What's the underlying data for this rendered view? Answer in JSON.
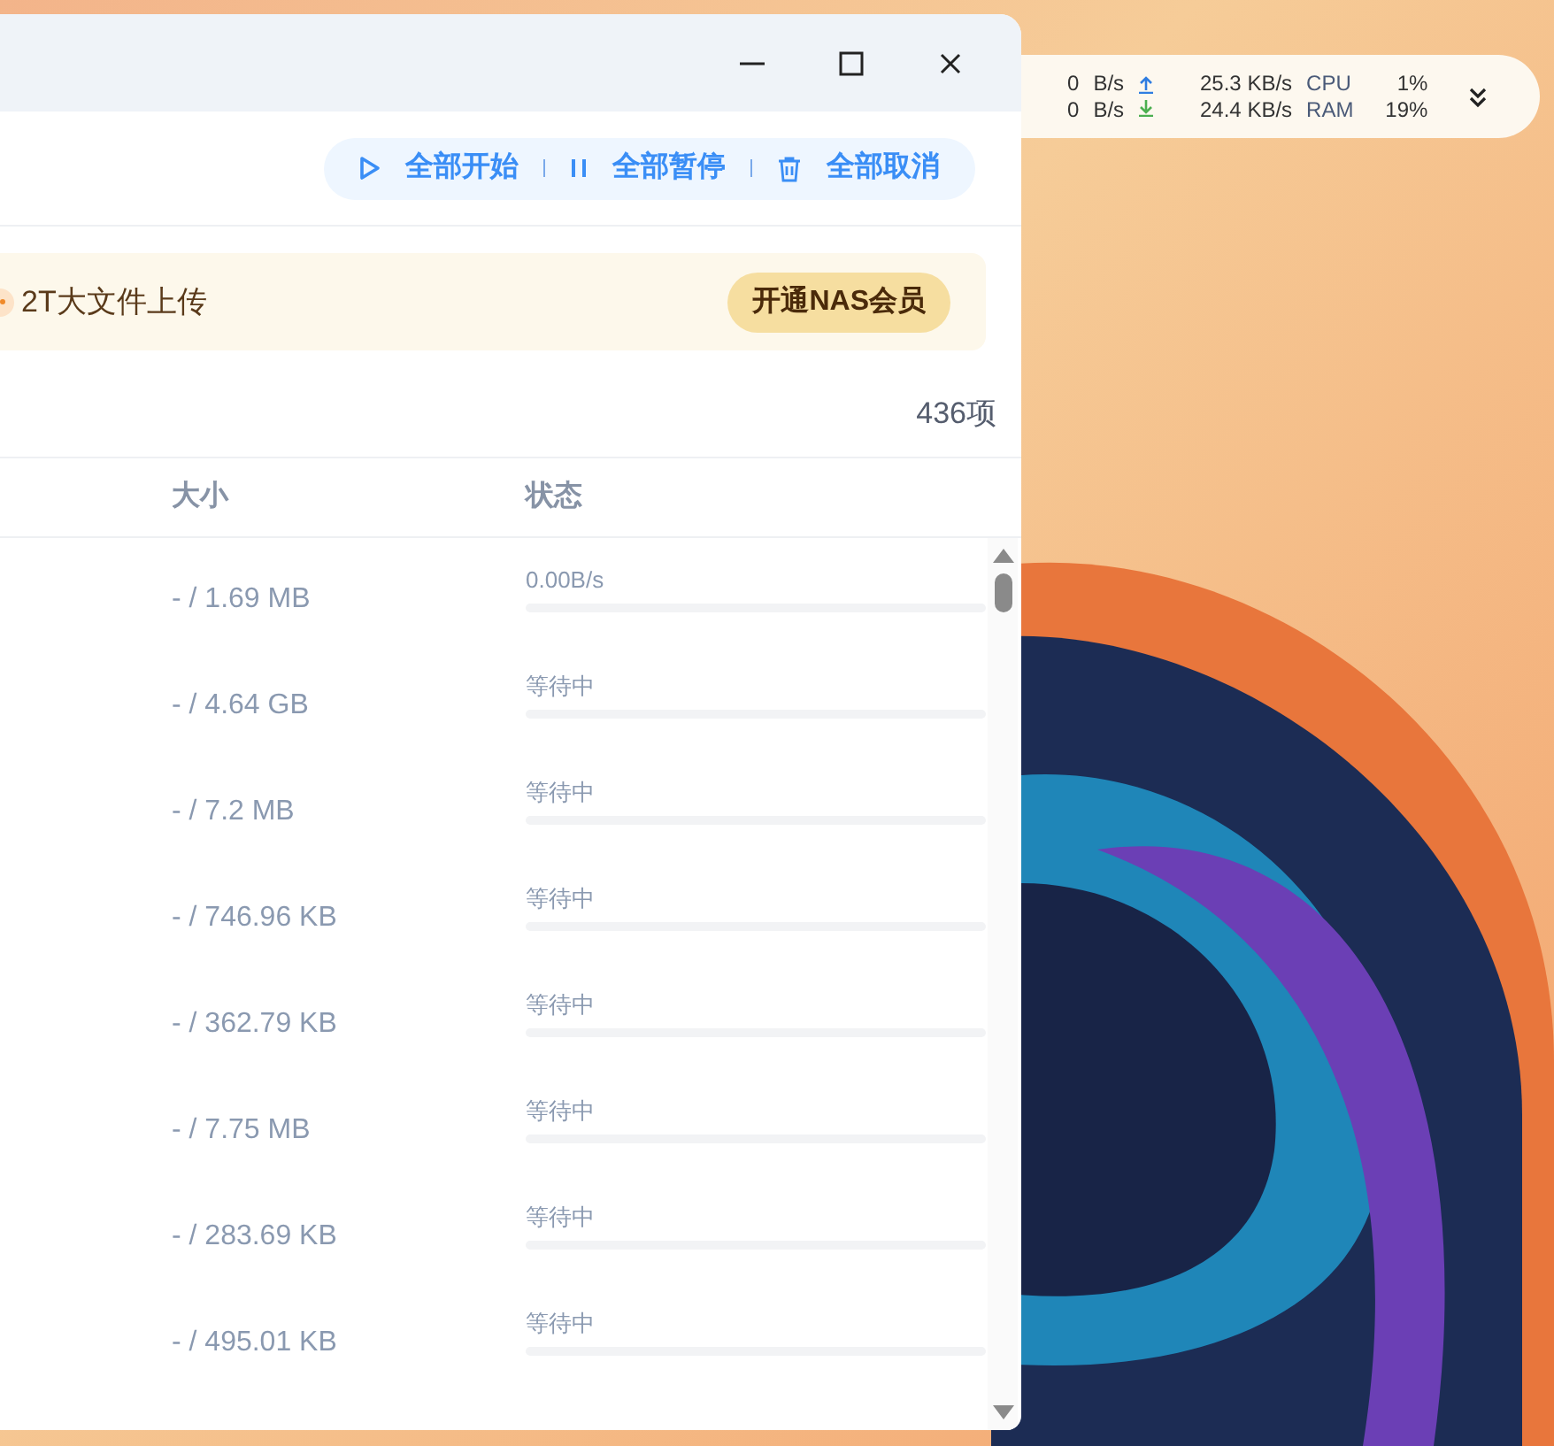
{
  "toolbar": {
    "buttons": [
      {
        "kind": "start",
        "label": "全部开始"
      },
      {
        "kind": "pause",
        "label": "全部暂停"
      },
      {
        "kind": "cancel",
        "label": "全部取消"
      }
    ]
  },
  "banner": {
    "text": "2T大文件上传",
    "button": "开通NAS会员"
  },
  "count": "436项",
  "table": {
    "columns": [
      "大小",
      "状态"
    ],
    "rows": [
      {
        "size": "- / 1.69 MB",
        "status": "0.00B/s",
        "level": 0
      },
      {
        "size": "- / 4.64 GB",
        "status": "等待中",
        "level": 0
      },
      {
        "size": "- / 7.2 MB",
        "status": "等待中",
        "level": 0
      },
      {
        "size": "- / 746.96 KB",
        "status": "等待中",
        "level": 0
      },
      {
        "size": "- / 362.79 KB",
        "status": "等待中",
        "level": 0
      },
      {
        "size": "- / 7.75 MB",
        "status": "等待中",
        "level": 0
      },
      {
        "size": "- / 283.69 KB",
        "status": "等待中",
        "level": 0
      },
      {
        "size": "- / 495.01 KB",
        "status": "等待中",
        "level": 0
      }
    ]
  },
  "net_widget": {
    "upload": "0",
    "upload_unit": "B/s",
    "download": "0",
    "download_unit": "B/s",
    "total_up": "25.3 KB/s",
    "total_down": "24.4 KB/s",
    "cpu_label": "CPU",
    "cpu": "1%",
    "ram_label": "RAM",
    "ram": "19%"
  }
}
